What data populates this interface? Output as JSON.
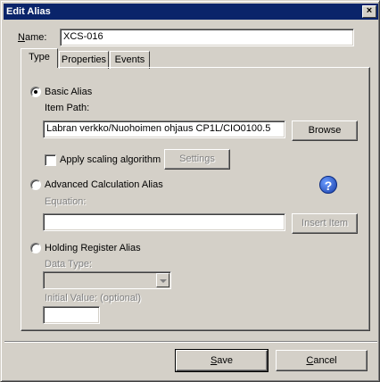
{
  "window": {
    "title": "Edit Alias",
    "close_label": "×"
  },
  "name_field": {
    "label": "Name:",
    "value": "XCS-016"
  },
  "tabs": [
    {
      "label": "Type"
    },
    {
      "label": "Properties"
    },
    {
      "label": "Events"
    }
  ],
  "basic_alias": {
    "label": "Basic Alias",
    "selected": true,
    "item_path_label": "Item Path:",
    "item_path_value": "Labran verkko/Nuohoimen ohjaus CP1L/CIO0100.5",
    "browse_label": "Browse",
    "scaling_label": "Apply scaling algorithm",
    "settings_label": "Settings"
  },
  "advanced_alias": {
    "label": "Advanced Calculation Alias",
    "equation_label": "Equation:",
    "equation_value": "",
    "insert_item_label": "Insert Item",
    "help_glyph": "?"
  },
  "holding_register_alias": {
    "label": "Holding Register Alias",
    "data_type_label": "Data Type:",
    "data_type_value": "",
    "initial_value_label": "Initial Value: (optional)",
    "initial_value": ""
  },
  "footer": {
    "save_label": "Save",
    "cancel_label": "Cancel"
  },
  "colors": {
    "titlebar": "#0a246a",
    "face": "#d4d0c8",
    "help_icon": "#1a3fa8"
  }
}
